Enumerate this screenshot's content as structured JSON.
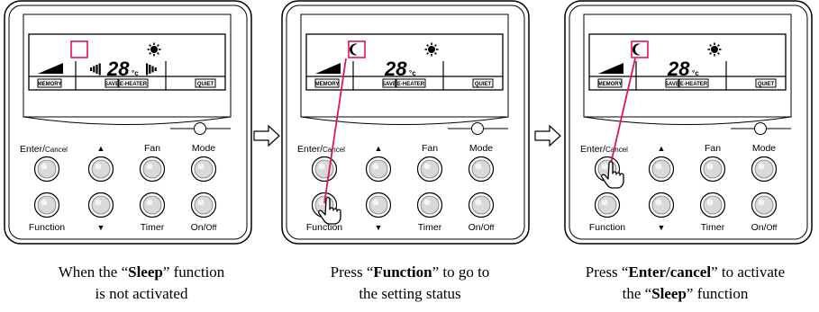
{
  "lcd": {
    "temperature": "28",
    "unit": "°c",
    "badges": {
      "memory": "MEMORY",
      "save": "SAVE",
      "e_heater": "E-HEATER",
      "quiet": "QUIET"
    }
  },
  "buttons": {
    "enter_cancel": "Enter/",
    "enter_cancel_small": "Cancel",
    "up": "▲",
    "fan": "Fan",
    "mode": "Mode",
    "function": "Function",
    "down": "▼",
    "timer": "Timer",
    "on_off": "On/",
    "on_off_small": "Off"
  },
  "panels": [
    {
      "sleep_icon_shown": false,
      "caption": {
        "l1_pre": "When the “",
        "l1_bold": "Sleep",
        "l1_post": "” function",
        "l2": "is not activated"
      }
    },
    {
      "sleep_icon_shown": true,
      "pointer_on": "function",
      "caption": {
        "l1_pre": "Press “",
        "l1_bold": "Function",
        "l1_post": "” to go to",
        "l2": "the setting status"
      }
    },
    {
      "sleep_icon_shown": true,
      "pointer_on": "enter_cancel",
      "caption": {
        "l1_pre": "Press “",
        "l1_bold": "Enter/cancel",
        "l1_post": "” to activate",
        "l2_pre": "the “",
        "l2_bold": "Sleep",
        "l2_post": "” function"
      }
    }
  ],
  "colors": {
    "highlight": "#e0174f",
    "frame": "#000000",
    "button_fill": "#d9d9d9"
  }
}
